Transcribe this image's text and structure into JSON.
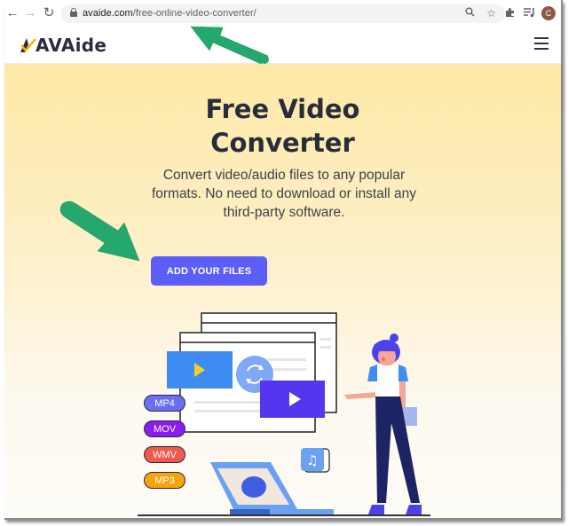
{
  "browser": {
    "url_domain": "avaide.com",
    "url_path": "/free-online-video-converter/",
    "profile_initial": "C",
    "nav": {
      "back_icon": "arrow-left-icon",
      "forward_icon": "arrow-right-icon",
      "reload_icon": "reload-icon"
    },
    "toolbar_icons": [
      "zoom-icon",
      "bookmark-star-icon",
      "extensions-puzzle-icon",
      "media-queue-icon"
    ]
  },
  "site": {
    "logo_text": "AVAide",
    "menu_icon": "hamburger-menu-icon"
  },
  "hero": {
    "title_line1": "Free Video",
    "title_line2": "Converter",
    "subtitle_line1": "Convert video/audio files to any popular",
    "subtitle_line2": "formats. No need to download or install any",
    "subtitle_line3": "third-party software.",
    "cta_label": "ADD YOUR FILES"
  },
  "illustration": {
    "formats": [
      {
        "label": "MP4",
        "color": "#6b6ef5"
      },
      {
        "label": "MOV",
        "color": "#8a1cf0"
      },
      {
        "label": "WMV",
        "color": "#ef5a4d"
      },
      {
        "label": "MP3",
        "color": "#f7a30e"
      }
    ]
  },
  "colors": {
    "accent": "#5b5ef7",
    "annotation_arrow": "#25a86e",
    "hero_bg_top": "#fde9a6"
  }
}
